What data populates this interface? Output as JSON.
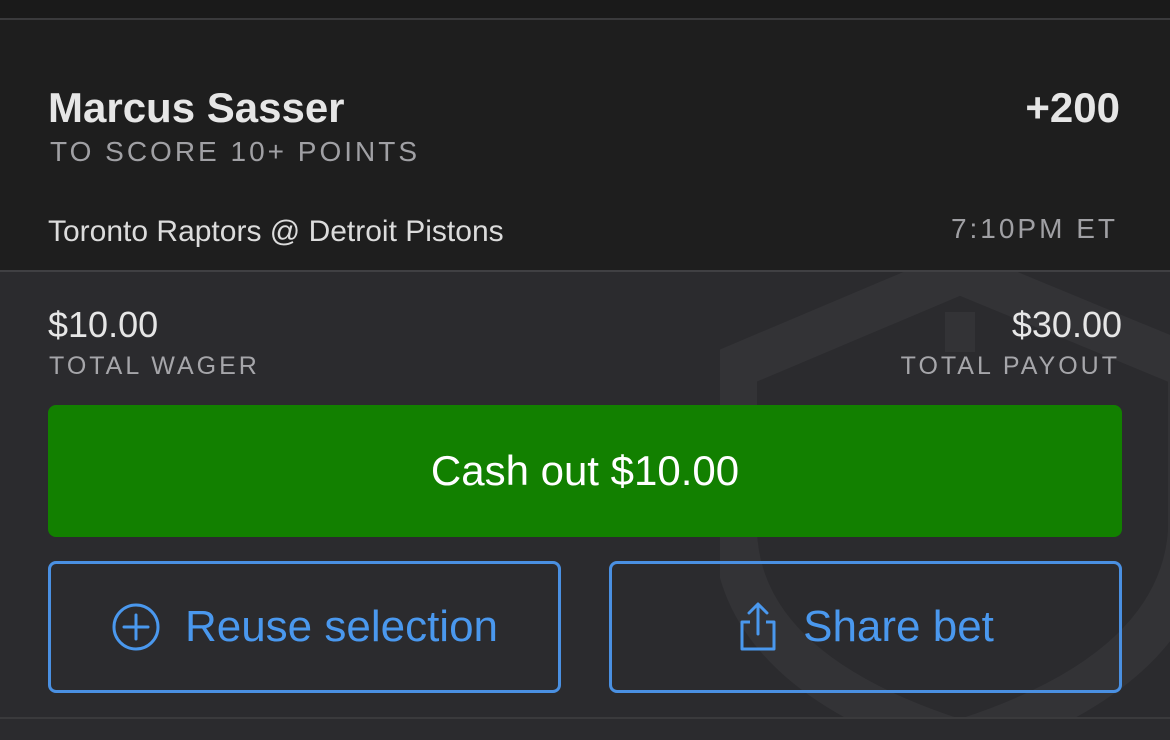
{
  "bet": {
    "player_name": "Marcus Sasser",
    "market": "TO SCORE 10+ POINTS",
    "odds": "+200",
    "matchup": "Toronto Raptors @ Detroit Pistons",
    "game_time": "7:10PM ET"
  },
  "amounts": {
    "wager_value": "$10.00",
    "wager_label": "TOTAL WAGER",
    "payout_value": "$30.00",
    "payout_label": "TOTAL PAYOUT"
  },
  "actions": {
    "cashout_label": "Cash out $10.00",
    "reuse_label": "Reuse selection",
    "share_label": "Share bet"
  },
  "icons": {
    "reuse": "plus-circle-icon",
    "share": "share-icon",
    "watermark": "shield-logo-icon"
  },
  "colors": {
    "cashout_green": "#128000",
    "accent_blue": "#4a90e2"
  }
}
